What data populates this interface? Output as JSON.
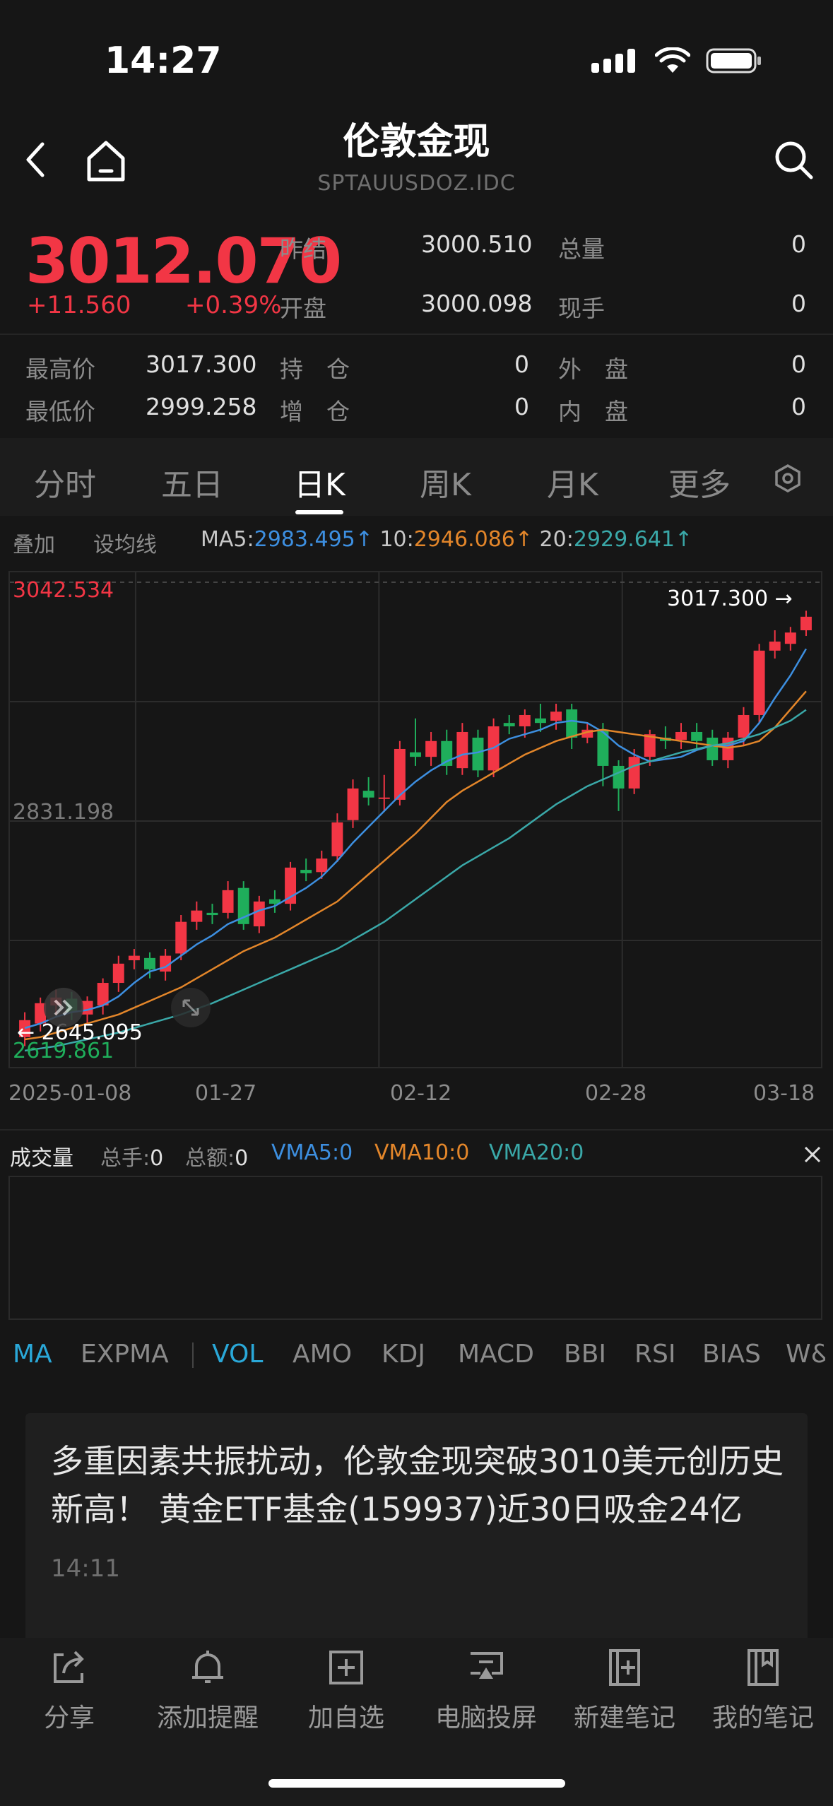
{
  "status": {
    "time": "14:27"
  },
  "header": {
    "title": "伦敦金现",
    "code": "SPTAUUSDOZ.IDC"
  },
  "quote": {
    "price": "3012.070",
    "change": "+11.560",
    "change_pct": "+0.39%",
    "prev_settle_label": "昨结",
    "prev_settle": "3000.510",
    "open_label": "开盘",
    "open": "3000.098",
    "total_vol_label": "总量",
    "total_vol": "0",
    "current_hand_label": "现手",
    "current_hand": "0",
    "high_label": "最高价",
    "high": "3017.300",
    "low_label": "最低价",
    "low": "2999.258",
    "position_label": "持　仓",
    "position": "0",
    "increase_label": "增　仓",
    "increase": "0",
    "outer_label": "外　盘",
    "outer": "0",
    "inner_label": "内　盘",
    "inner": "0"
  },
  "tabs": [
    "分时",
    "五日",
    "日K",
    "周K",
    "月K",
    "更多"
  ],
  "active_tab": 2,
  "ma_bar": {
    "overlay": "叠加",
    "set_ma": "设均线",
    "ma5_label": "MA5:",
    "ma5": "2983.495↑",
    "ma10_label": "10:",
    "ma10": "2946.086↑",
    "ma20_label": "20:",
    "ma20": "2929.641↑"
  },
  "colors": {
    "up": "#f23645",
    "down": "#1fae5b",
    "ma5": "#3d8fe0",
    "ma10": "#e3862a",
    "ma20": "#3aa8a8"
  },
  "chart_data": {
    "type": "candlestick",
    "y_max_label": "3042.534",
    "y_mid_label": "2831.198",
    "y_min_label": "2619.861",
    "ylim": [
      2619.861,
      3042.534
    ],
    "high_annotation": "3017.300 →",
    "low_annotation": "← 2645.095",
    "x_labels": [
      "2025-01-08",
      "01-27",
      "02-12",
      "02-28",
      "03-18"
    ],
    "candles": [
      [
        2640,
        2655,
        2632,
        2662
      ],
      [
        2652,
        2670,
        2645,
        2675
      ],
      [
        2668,
        2675,
        2660,
        2682
      ],
      [
        2674,
        2662,
        2655,
        2680
      ],
      [
        2660,
        2672,
        2652,
        2676
      ],
      [
        2668,
        2688,
        2660,
        2692
      ],
      [
        2688,
        2705,
        2680,
        2712
      ],
      [
        2708,
        2712,
        2700,
        2718
      ],
      [
        2710,
        2700,
        2692,
        2715
      ],
      [
        2698,
        2712,
        2690,
        2718
      ],
      [
        2714,
        2742,
        2708,
        2748
      ],
      [
        2742,
        2752,
        2735,
        2760
      ],
      [
        2750,
        2748,
        2740,
        2758
      ],
      [
        2750,
        2770,
        2745,
        2778
      ],
      [
        2772,
        2740,
        2735,
        2778
      ],
      [
        2738,
        2760,
        2732,
        2765
      ],
      [
        2762,
        2758,
        2750,
        2770
      ],
      [
        2758,
        2790,
        2752,
        2795
      ],
      [
        2788,
        2785,
        2778,
        2798
      ],
      [
        2786,
        2798,
        2780,
        2805
      ],
      [
        2800,
        2830,
        2795,
        2838
      ],
      [
        2832,
        2860,
        2825,
        2868
      ],
      [
        2858,
        2852,
        2845,
        2870
      ],
      [
        2852,
        2852,
        2840,
        2872
      ],
      [
        2850,
        2895,
        2845,
        2902
      ],
      [
        2892,
        2888,
        2880,
        2922
      ],
      [
        2888,
        2902,
        2880,
        2910
      ],
      [
        2902,
        2880,
        2872,
        2912
      ],
      [
        2878,
        2910,
        2872,
        2918
      ],
      [
        2905,
        2876,
        2870,
        2912
      ],
      [
        2876,
        2915,
        2870,
        2922
      ],
      [
        2918,
        2915,
        2908,
        2925
      ],
      [
        2915,
        2925,
        2905,
        2930
      ],
      [
        2922,
        2918,
        2910,
        2935
      ],
      [
        2920,
        2928,
        2912,
        2935
      ],
      [
        2930,
        2905,
        2895,
        2935
      ],
      [
        2905,
        2912,
        2900,
        2918
      ],
      [
        2912,
        2880,
        2862,
        2918
      ],
      [
        2880,
        2860,
        2840,
        2885
      ],
      [
        2860,
        2888,
        2855,
        2895
      ],
      [
        2888,
        2908,
        2880,
        2912
      ],
      [
        2905,
        2902,
        2895,
        2915
      ],
      [
        2903,
        2910,
        2895,
        2918
      ],
      [
        2910,
        2902,
        2895,
        2918
      ],
      [
        2905,
        2885,
        2880,
        2912
      ],
      [
        2885,
        2905,
        2878,
        2910
      ],
      [
        2905,
        2925,
        2898,
        2932
      ],
      [
        2925,
        2982,
        2918,
        2988
      ],
      [
        2982,
        2990,
        2975,
        3000
      ],
      [
        2988,
        2998,
        2982,
        3003
      ],
      [
        3000,
        3012,
        2995,
        3017.3
      ]
    ],
    "candle_format": [
      "open",
      "close",
      "low",
      "high"
    ],
    "series": [
      {
        "name": "MA5",
        "values": [
          2648,
          2652,
          2658,
          2662,
          2664,
          2668,
          2676,
          2688,
          2698,
          2702,
          2712,
          2722,
          2730,
          2740,
          2746,
          2752,
          2756,
          2764,
          2772,
          2782,
          2796,
          2812,
          2826,
          2840,
          2854,
          2866,
          2876,
          2884,
          2890,
          2892,
          2896,
          2904,
          2908,
          2912,
          2918,
          2920,
          2918,
          2910,
          2898,
          2890,
          2884,
          2886,
          2888,
          2894,
          2898,
          2898,
          2902,
          2918,
          2940,
          2960,
          2983.495
        ]
      },
      {
        "name": "10",
        "values": [
          2638,
          2640,
          2644,
          2648,
          2652,
          2656,
          2660,
          2666,
          2672,
          2678,
          2684,
          2692,
          2700,
          2708,
          2716,
          2722,
          2728,
          2736,
          2744,
          2752,
          2760,
          2772,
          2784,
          2796,
          2808,
          2820,
          2834,
          2848,
          2858,
          2866,
          2874,
          2882,
          2890,
          2896,
          2902,
          2906,
          2910,
          2912,
          2910,
          2908,
          2906,
          2904,
          2902,
          2900,
          2898,
          2896,
          2898,
          2902,
          2914,
          2930,
          2946.086
        ]
      },
      {
        "name": "20",
        "values": [
          2628,
          2630,
          2632,
          2635,
          2638,
          2641,
          2644,
          2648,
          2652,
          2656,
          2660,
          2665,
          2670,
          2676,
          2682,
          2688,
          2694,
          2700,
          2706,
          2712,
          2718,
          2726,
          2734,
          2742,
          2752,
          2762,
          2772,
          2782,
          2792,
          2800,
          2808,
          2816,
          2826,
          2836,
          2846,
          2854,
          2862,
          2868,
          2874,
          2880,
          2884,
          2888,
          2892,
          2895,
          2898,
          2900,
          2904,
          2908,
          2914,
          2920,
          2929.641
        ]
      }
    ]
  },
  "volume": {
    "title": "成交量",
    "total_hand_label": "总手:",
    "total_hand": "0",
    "amount_label": "总额:",
    "amount": "0",
    "vma5": "VMA5:0",
    "vma10": "VMA10:0",
    "vma20": "VMA20:0"
  },
  "indicators": [
    "MA",
    "EXPMA",
    "VOL",
    "AMO",
    "KDJ",
    "MACD",
    "BBI",
    "RSI",
    "BIAS",
    "W&"
  ],
  "news": {
    "title": "多重因素共振扰动，伦敦金现突破3010美元创历史新高！ 黄金ETF基金(159937)近30日吸金24亿",
    "time": "14:11"
  },
  "bottom_bar": [
    "分享",
    "添加提醒",
    "加自选",
    "电脑投屏",
    "新建笔记",
    "我的笔记"
  ]
}
